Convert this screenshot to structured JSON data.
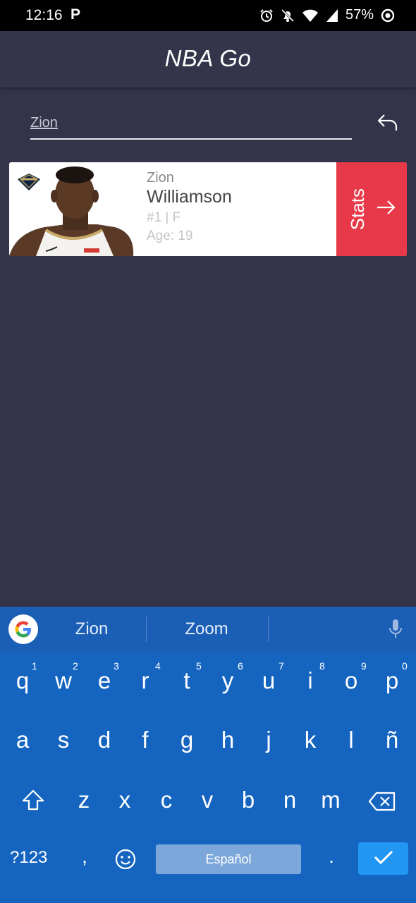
{
  "status_bar": {
    "time": "12:16",
    "app_letter": "P",
    "battery": "57%"
  },
  "app": {
    "title": "NBA Go"
  },
  "search": {
    "value": "Zion"
  },
  "player": {
    "first_name": "Zion",
    "last_name": "Williamson",
    "number_position": "#1 | F",
    "age": "Age: 19",
    "stats_label": "Stats"
  },
  "keyboard": {
    "suggestions": [
      "Zion",
      "Zoom"
    ],
    "row1": [
      "q",
      "w",
      "e",
      "r",
      "t",
      "y",
      "u",
      "i",
      "o",
      "p"
    ],
    "row1_hints": [
      "1",
      "2",
      "3",
      "4",
      "5",
      "6",
      "7",
      "8",
      "9",
      "0"
    ],
    "row2": [
      "a",
      "s",
      "d",
      "f",
      "g",
      "h",
      "j",
      "k",
      "l",
      "ñ"
    ],
    "row3": [
      "z",
      "x",
      "c",
      "v",
      "b",
      "n",
      "m"
    ],
    "symbols_label": "?123",
    "comma": ",",
    "space_label": "Español",
    "period": "."
  },
  "colors": {
    "background": "#33344a",
    "stats_button": "#e8394a",
    "keyboard": "#1565c0"
  },
  "icons": [
    "alarm-icon",
    "bell-off-icon",
    "wifi-icon",
    "signal-icon",
    "battery-icon",
    "back-arrow-icon",
    "arrow-right-icon",
    "google-icon",
    "mic-icon",
    "shift-icon",
    "backspace-icon",
    "emoji-icon",
    "check-icon"
  ]
}
